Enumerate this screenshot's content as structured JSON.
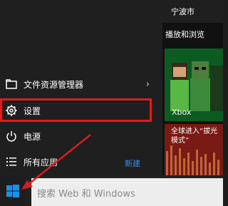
{
  "start_menu": {
    "items": [
      {
        "label": "文件资源管理器",
        "icon": "folder-icon"
      },
      {
        "label": "设置",
        "icon": "gear-icon"
      },
      {
        "label": "电源",
        "icon": "power-icon"
      },
      {
        "label": "所有应用",
        "icon": "list-icon"
      }
    ],
    "new_label": "新建",
    "highlight_color": "#d81e1e"
  },
  "tiles": {
    "city": "宁波市",
    "section_title": "播放和浏览",
    "xbox_label": "Xbox",
    "news_text": "全球进入“拔光模式”"
  },
  "taskbar": {
    "search_placeholder": "搜索 Web 和 Windows"
  },
  "colors": {
    "accent": "#3a8ee6",
    "xbox": "#0c5b23",
    "news": "#8b1f18",
    "arrow": "#d81e1e"
  }
}
